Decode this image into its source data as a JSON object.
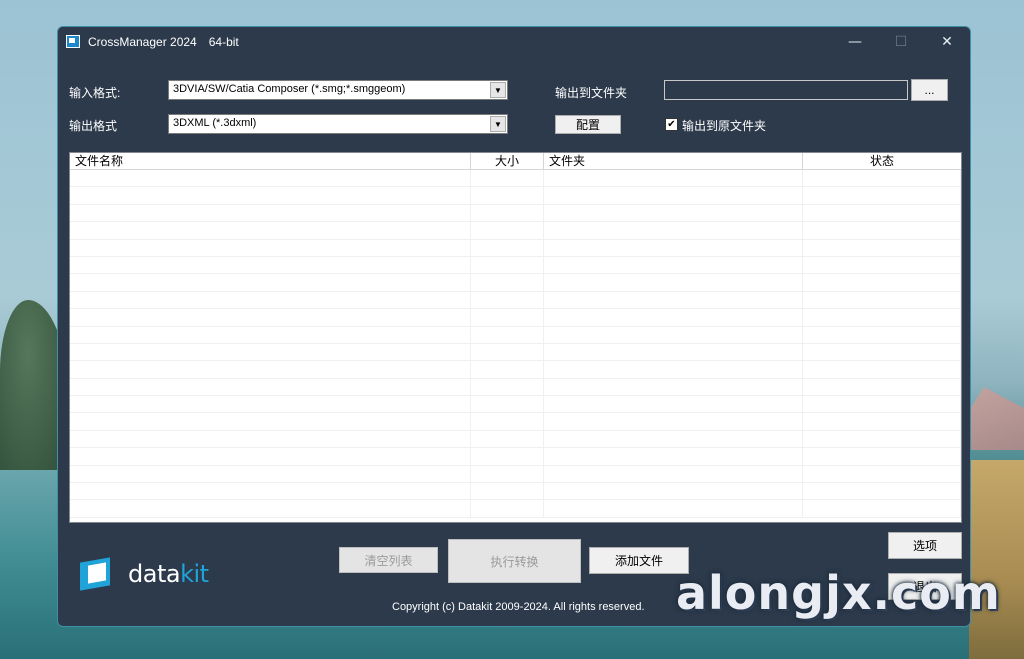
{
  "desktop": {
    "watermark": "alongjx.com"
  },
  "window": {
    "title": "CrossManager 2024",
    "bits": "64-bit",
    "controls": {
      "minimize": "—",
      "maximize": "☐",
      "close": "✕"
    }
  },
  "form": {
    "input_format_label": "输入格式:",
    "input_format_value": "3DVIA/SW/Catia Composer (*.smg;*.smggeom)",
    "output_format_label": "输出格式",
    "output_format_value": "3DXML (*.3dxml)",
    "output_folder_label": "输出到文件夹",
    "output_folder_value": "",
    "browse_label": "...",
    "config_label": "配置",
    "output_to_source_label": "输出到原文件夹",
    "output_to_source_checked": true,
    "check_glyph": "✔"
  },
  "list": {
    "columns": [
      "文件名称",
      "大小",
      "文件夹",
      "状态"
    ],
    "rows": []
  },
  "actions": {
    "clear_list": "清空列表",
    "execute": "执行转换",
    "add_files": "添加文件",
    "options": "选项",
    "exit": "退出"
  },
  "footer": {
    "logo_data": "data",
    "logo_kit": "kit",
    "copyright": "Copyright (c) Datakit 2009-2024. All rights reserved."
  },
  "colors": {
    "window_bg": "#2c3a4b",
    "accent": "#1fa3d8",
    "border": "#3f8fa8"
  }
}
